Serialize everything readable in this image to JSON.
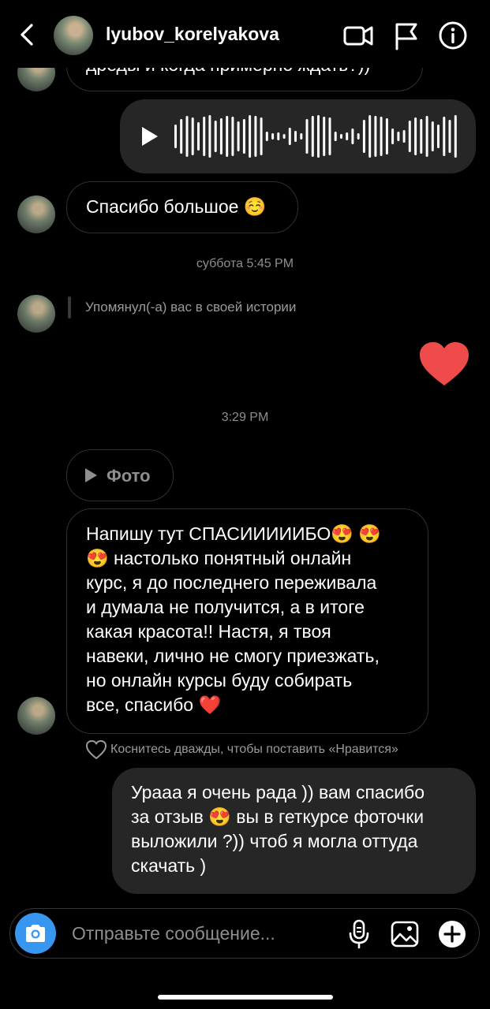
{
  "header": {
    "username": "lyubov_korelyakova",
    "icons": [
      "back-chevron-icon",
      "video-call-icon",
      "flag-icon",
      "info-icon"
    ]
  },
  "messages": {
    "partial_top_text": "дреды и когда примерно ждать?))",
    "voice": {
      "icon": "play-icon"
    },
    "thanks_text": "Спасибо большое ☺️",
    "stamp_saturday": "суббота 5:45 PM",
    "mention_text": "Упомянул(-а) вас в своей истории",
    "heart_reaction": "heart-icon",
    "stamp_time": "3:29 PM",
    "photo_label": "Фото",
    "long_message_lines": [
      "Напишу тут СПАСИИИИИБО😍 😍",
      "😍 настолько понятный онлайн",
      "курс, я до последнего переживала",
      "и думала не получится, а в итоге",
      "какая красота!! Настя, я твоя",
      "навеки, лично не смогу приезжать,",
      "но онлайн курсы буду собирать",
      "все, спасибо ❤️"
    ],
    "like_hint": "Коснитесь дважды, чтобы поставить «Нравится»",
    "reply_lines": [
      "Урааа я очень рада )) вам спасибо",
      "за отзыв 😍  вы в геткурсе фоточки",
      "выложили ?)) чтоб я могла оттуда",
      "скачать )"
    ]
  },
  "composer": {
    "placeholder": "Отправьте сообщение...",
    "icons": [
      "camera-icon",
      "microphone-icon",
      "gallery-icon",
      "plus-icon"
    ]
  },
  "colors": {
    "background": "#000000",
    "bubble_outgoing": "#262626",
    "bubble_border": "#303030",
    "accent_blue": "#3797f0",
    "heart_red": "#ef4b4b",
    "muted_text": "#8e8e8e"
  }
}
